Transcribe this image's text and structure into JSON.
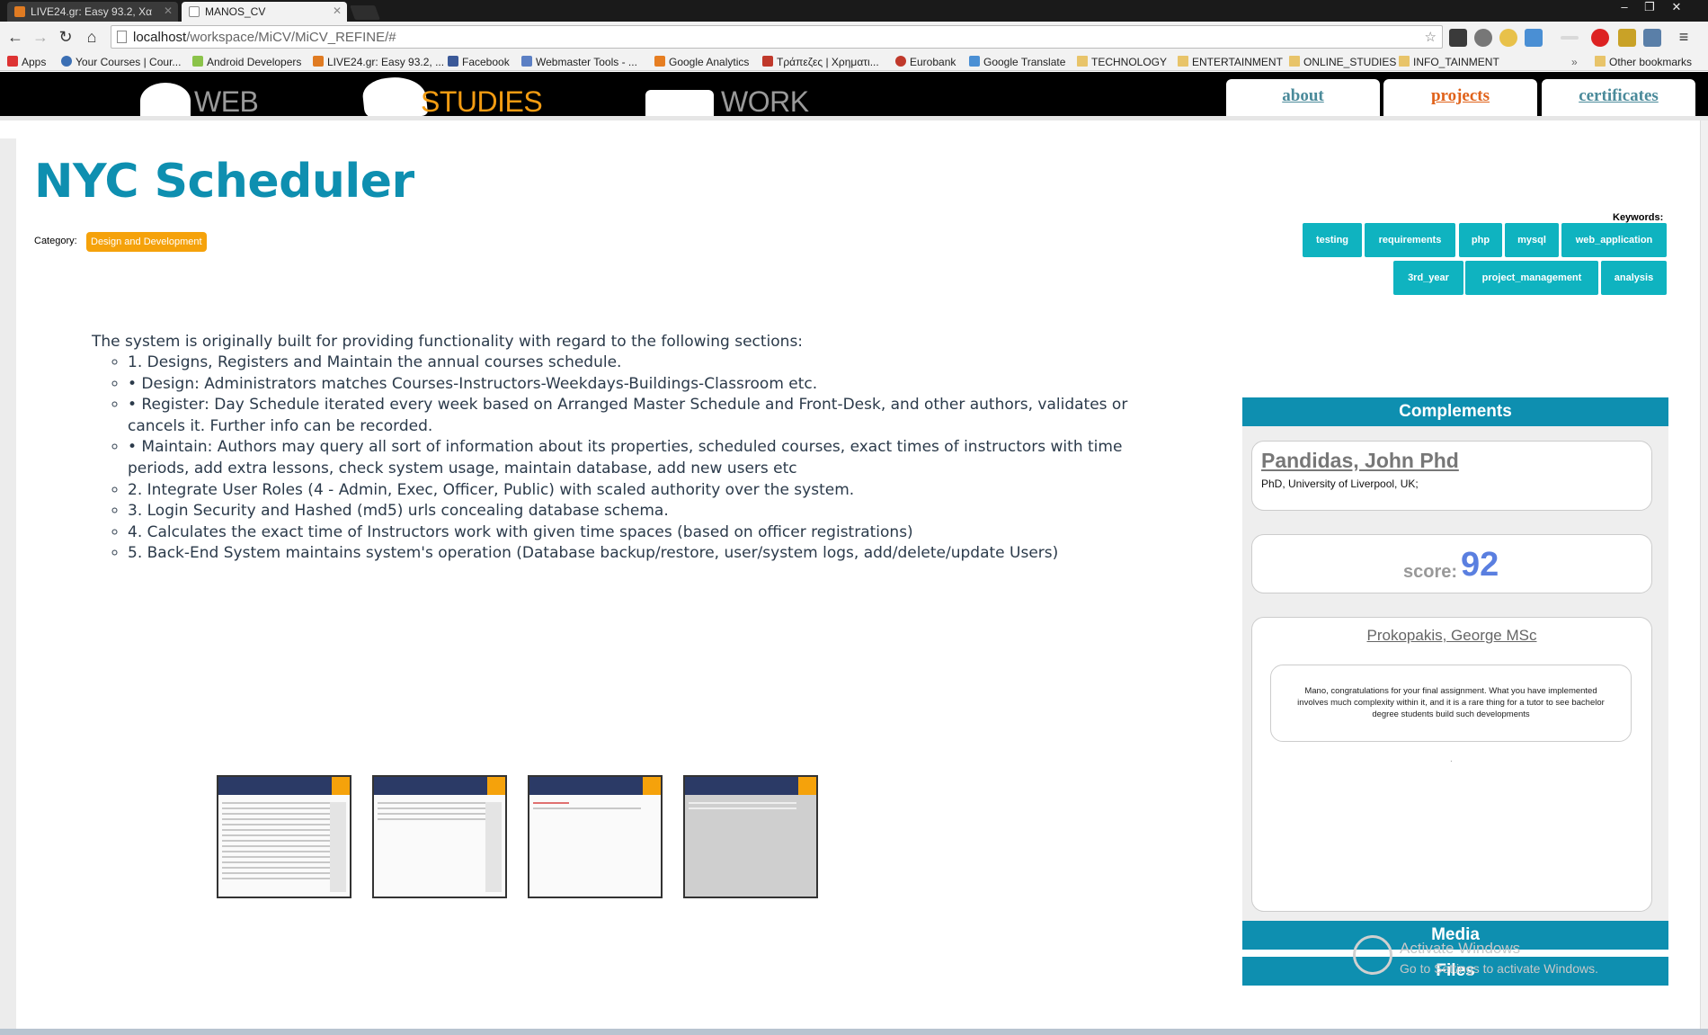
{
  "browser": {
    "tabs": [
      {
        "title": "LIVE24.gr: Easy 93.2, Xα",
        "active": false
      },
      {
        "title": "MANOS_CV",
        "active": true
      }
    ],
    "url_host": "localhost",
    "url_path": "/workspace/MiCV/MiCV_REFINE/#",
    "bookmarks": [
      "Apps",
      "Your Courses | Cour...",
      "Android Developers",
      "LIVE24.gr: Easy 93.2, ...",
      "Facebook",
      "Webmaster Tools - ...",
      "Google Analytics",
      "Τράπεζες | Χρηματι...",
      "Eurobank",
      "Google Translate",
      "TECHNOLOGY",
      "ENTERTAINMENT",
      "ONLINE_STUDIES",
      "INFO_TAINMENT",
      "Other bookmarks"
    ],
    "overflow_chevron": "»"
  },
  "site_nav": {
    "sections": [
      "WEB",
      "STUDIES",
      "WORK"
    ],
    "active_section": "STUDIES",
    "tabs": [
      "about",
      "projects",
      "certificates"
    ],
    "active_tab": "projects"
  },
  "project": {
    "title": "NYC Scheduler",
    "category_label": "Category:",
    "category": "Design and Development",
    "keywords_label": "Keywords:",
    "keywords": [
      "testing",
      "requirements",
      "php",
      "mysql",
      "web_application",
      "3rd_year",
      "project_management",
      "analysis"
    ],
    "intro": "The system is originally built for providing functionality with regard to the following sections:",
    "items": [
      "1. Designs, Registers and Maintain the annual courses schedule.",
      "• Design: Administrators matches Courses-Instructors-Weekdays-Buildings-Classroom etc.",
      "• Register: Day Schedule iterated every week based on Arranged Master Schedule and Front-Desk, and other authors, validates or cancels it. Further info can be recorded.",
      "• Maintain: Authors may query all sort of information about its properties, scheduled courses, exact times of instructors with time periods, add extra lessons, check system usage, maintain database, add new users etc",
      "2. Integrate User Roles (4 - Admin, Exec, Officer, Public) with scaled authority over the system.",
      "3. Login Security and Hashed (md5) urls concealing database schema.",
      "4. Calculates the exact time of Instructors work with given time spaces (based on officer registrations)",
      "5. Back-End System maintains system's operation (Database backup/restore, user/system logs, add/delete/update Users)"
    ]
  },
  "sidebar": {
    "complements_title": "Complements",
    "reviewer1_name": "Pandidas, John Phd",
    "reviewer1_affiliation": "PhD, University of Liverpool, UK;",
    "score_label": "score:",
    "score_value": "92",
    "reviewer2_name": "Prokopakis, George MSc",
    "reviewer2_quote": "Mano, congratulations for your final assignment. What you have implemented involves much complexity within it, and it is a rare thing for a tutor to see bachelor degree students build such developments",
    "reviewer2_dot": ".",
    "media_title": "Media",
    "files_title": "Files"
  },
  "os_watermark": {
    "line1": "Activate Windows",
    "line2": "Go to Settings to activate Windows."
  },
  "colors": {
    "accent_teal": "#0e8fb0",
    "keyword_bg": "#0fb3c0",
    "category_orange": "#f5a20b",
    "active_nav": "#f39c12",
    "projects_tab": "#e0621a"
  }
}
